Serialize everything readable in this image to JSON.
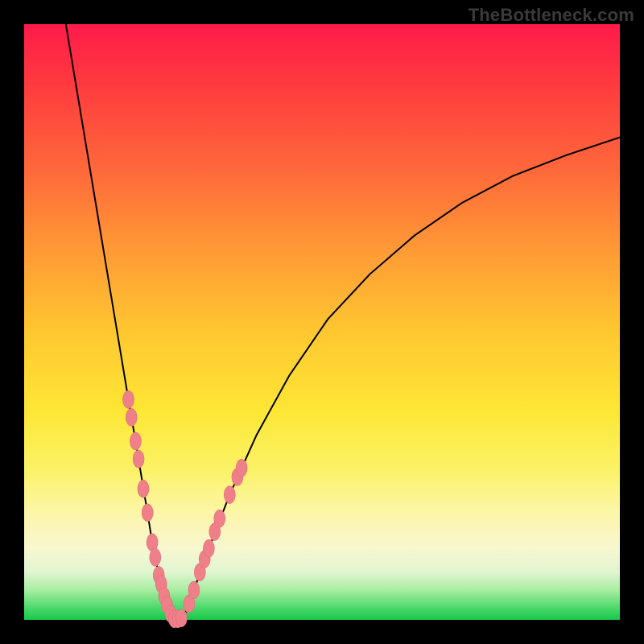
{
  "watermark": "TheBottleneck.com",
  "colors": {
    "background_black": "#000000",
    "gradient_top": "#ff1a4a",
    "gradient_bottom": "#15c84a",
    "curve_color": "#000000",
    "bead_fill": "#ef7f89",
    "bead_stroke": "#d96a74"
  },
  "chart_data": {
    "type": "line",
    "title": "",
    "xlabel": "",
    "ylabel": "",
    "xlim": [
      0,
      100
    ],
    "ylim": [
      0,
      100
    ],
    "grid": false,
    "legend": false,
    "description": "Bottleneck-style V curve centered around a single minimum; background vertical heatmap runs red (high) through yellow to green (low). Two coral bead clusters sit on the two arms of the V in the yellow/green band near the bottom.",
    "series": [
      {
        "name": "left-arm",
        "x": [
          7.0,
          8.5,
          10.0,
          11.5,
          13.0,
          14.5,
          16.0,
          17.5,
          18.7,
          19.7,
          20.7,
          21.5,
          22.3,
          23.0,
          23.5,
          24.0,
          24.4,
          24.8
        ],
        "y": [
          100,
          91,
          82,
          73,
          64,
          55,
          46,
          37,
          30,
          24,
          18,
          13,
          9,
          6,
          4,
          2.5,
          1.2,
          0.4
        ]
      },
      {
        "name": "valley",
        "x": [
          24.8,
          25.2,
          25.7,
          26.2,
          26.8
        ],
        "y": [
          0.4,
          0.15,
          0.1,
          0.15,
          0.4
        ]
      },
      {
        "name": "right-arm",
        "x": [
          26.8,
          28.5,
          31.0,
          34.5,
          39.0,
          44.5,
          51.0,
          58.0,
          65.5,
          73.5,
          82.0,
          91.0,
          100.0
        ],
        "y": [
          0.4,
          5.0,
          12.0,
          21.0,
          31.0,
          41.0,
          50.5,
          58.0,
          64.5,
          70.0,
          74.5,
          78.0,
          81.0
        ]
      }
    ],
    "beads_left": [
      {
        "x": 17.5,
        "y": 37
      },
      {
        "x": 18.0,
        "y": 34
      },
      {
        "x": 18.7,
        "y": 30
      },
      {
        "x": 19.2,
        "y": 27
      },
      {
        "x": 20.0,
        "y": 22
      },
      {
        "x": 20.7,
        "y": 18
      },
      {
        "x": 21.5,
        "y": 13
      },
      {
        "x": 22.0,
        "y": 10.5
      },
      {
        "x": 22.6,
        "y": 7.5
      },
      {
        "x": 23.0,
        "y": 6.0
      },
      {
        "x": 23.5,
        "y": 4.0
      },
      {
        "x": 24.0,
        "y": 2.5
      },
      {
        "x": 24.6,
        "y": 1.0
      },
      {
        "x": 25.2,
        "y": 0.15
      },
      {
        "x": 25.8,
        "y": 0.15
      },
      {
        "x": 26.4,
        "y": 0.3
      }
    ],
    "beads_right": [
      {
        "x": 27.7,
        "y": 2.7
      },
      {
        "x": 28.5,
        "y": 5.0
      },
      {
        "x": 29.5,
        "y": 8.0
      },
      {
        "x": 30.3,
        "y": 10.2
      },
      {
        "x": 31.0,
        "y": 12.0
      },
      {
        "x": 32.0,
        "y": 14.8
      },
      {
        "x": 32.8,
        "y": 17.0
      },
      {
        "x": 34.5,
        "y": 21.0
      },
      {
        "x": 35.8,
        "y": 24.0
      },
      {
        "x": 36.5,
        "y": 25.5
      }
    ]
  }
}
